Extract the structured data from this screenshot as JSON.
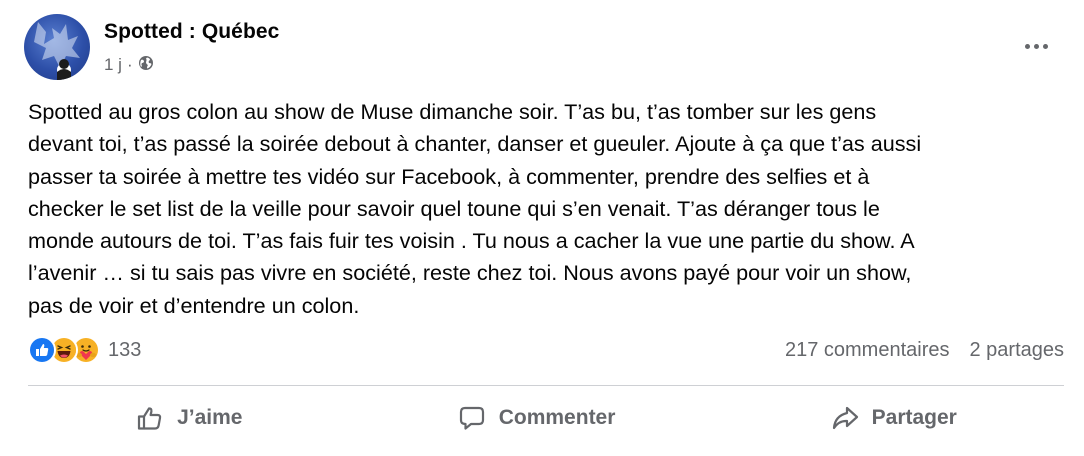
{
  "post": {
    "author": "Spotted : Québec",
    "time": "1 j",
    "separator": "·",
    "privacy_icon": "globe-icon",
    "more_icon": "more-options-icon",
    "text": "Spotted au gros colon au show de Muse dimanche soir. T’as bu, t’as tomber sur les gens\ndevant toi, t’as passé la soirée debout à chanter, danser et gueuler. Ajoute à ça que t’as aussi\npasser ta soirée à mettre tes vidéo sur Facebook, à commenter, prendre des selfies et à\nchecker le set list de la veille pour savoir quel toune qui s’en venait. T’as déranger tous le\nmonde autours de toi. T’as fais fuir tes voisin . Tu nous a cacher la vue une partie du show. A\nl’avenir … si tu sais pas vivre en société, reste chez toi. Nous avons payé pour voir un show,\npas de voir et d’entendre un colon."
  },
  "stats": {
    "reactions": [
      "like-icon",
      "haha-icon",
      "care-icon"
    ],
    "reaction_count": "133",
    "comments": "217 commentaires",
    "shares": "2 partages"
  },
  "actions": {
    "like": "J’aime",
    "comment": "Commenter",
    "share": "Partager"
  },
  "colors": {
    "text": "#050505",
    "secondary": "#65676b",
    "like_blue": "#1877f2",
    "divider": "#ced0d4"
  }
}
